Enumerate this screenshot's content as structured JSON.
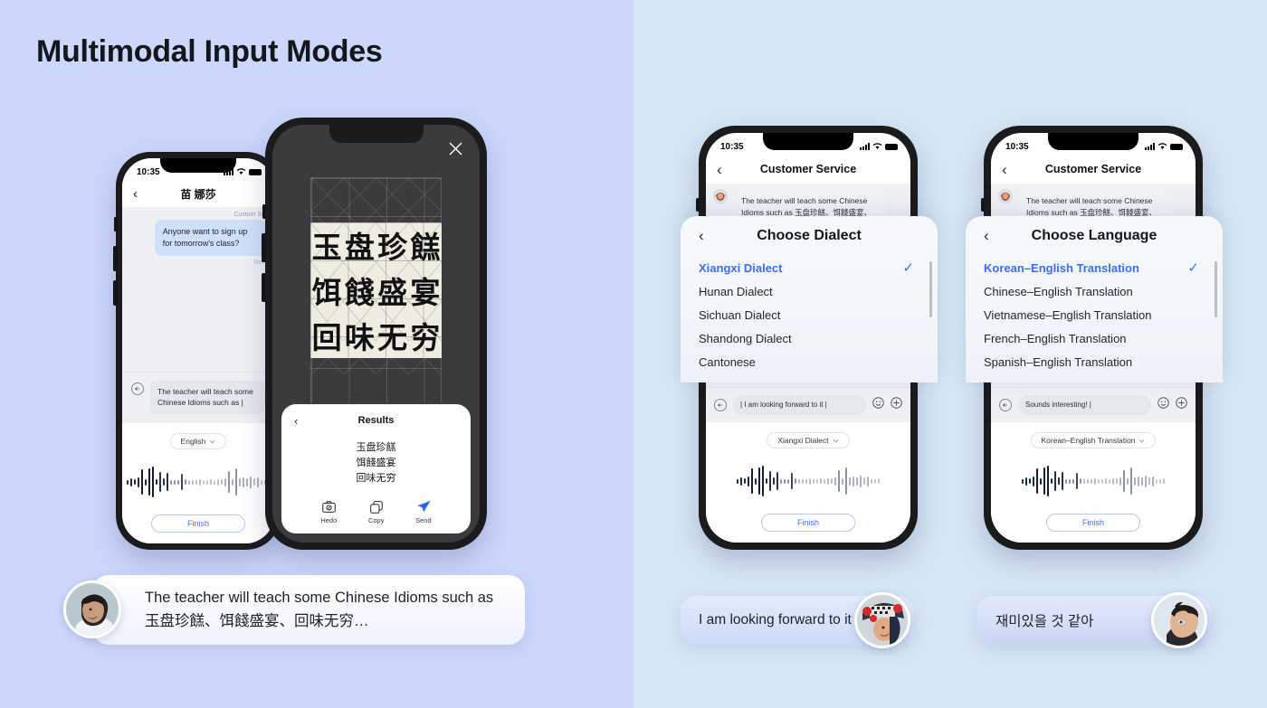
{
  "page": {
    "title": "Multimodal Input Modes",
    "bg_left": "#ccd7fc",
    "bg_right": "#d5e6f4",
    "accent": "#3b6df2"
  },
  "phone_chat": {
    "status": {
      "time": "10:35"
    },
    "nav": {
      "back": "‹",
      "title": "苗 娜莎"
    },
    "chat": {
      "meta_top": "Custom Se",
      "bubble": "Anyone want to sign up for tomorrow's class?",
      "meta_bottom": "Rec"
    },
    "composer": {
      "mic_icon": "speaker-icon",
      "text": "The teacher will teach some Chinese Idioms such as |"
    },
    "voice": {
      "lang_chip": "English",
      "chevron": "⌄",
      "finish": "Finish"
    }
  },
  "phone_dark": {
    "close_icon": "close-icon",
    "hanzi": [
      "玉",
      "盘",
      "珍",
      "餻",
      "饵",
      "餞",
      "盛",
      "宴",
      "回",
      "味",
      "无",
      "穷"
    ],
    "results": {
      "back": "‹",
      "title": "Results",
      "lines": [
        "玉盘珍餻",
        "饵餞盛宴",
        "回味无穷"
      ],
      "actions": [
        {
          "label": "Hedo",
          "icon": "camera-icon"
        },
        {
          "label": "Copy",
          "icon": "copy-icon"
        },
        {
          "label": "Send",
          "icon": "send-icon"
        }
      ]
    }
  },
  "phone_dialect": {
    "status": {
      "time": "10:35"
    },
    "nav": {
      "back": "‹",
      "title": "Customer Service"
    },
    "chat_bubble": "The teacher will teach some Chinese Idioms such as 玉盘珍餻、饵餞盛宴、回味无穷…",
    "sheet": {
      "back": "‹",
      "title": "Choose Dialect",
      "items": [
        {
          "label": "Xiangxi Dialect",
          "selected": true
        },
        {
          "label": "Hunan Dialect",
          "selected": false
        },
        {
          "label": "Sichuan Dialect",
          "selected": false
        },
        {
          "label": "Shandong Dialect",
          "selected": false
        },
        {
          "label": "Cantonese",
          "selected": false
        }
      ],
      "check": "✓"
    },
    "composer": {
      "text": "| I am looking forward to it |",
      "emoji_icon": "smiley-icon",
      "plus_icon": "plus-icon"
    },
    "voice": {
      "lang_chip": "Xiangxi Dialect",
      "chevron": "⌄",
      "finish": "Finish"
    }
  },
  "phone_language": {
    "status": {
      "time": "10:35"
    },
    "nav": {
      "back": "‹",
      "title": "Customer Service"
    },
    "chat_bubble": "The teacher will teach some Chinese Idioms such as 玉盘珍餻、饵餞盛宴、回味无穷…",
    "sheet": {
      "back": "‹",
      "title": "Choose Language",
      "items": [
        {
          "label": "Korean–English Translation",
          "selected": true
        },
        {
          "label": "Chinese–English Translation",
          "selected": false
        },
        {
          "label": "Vietnamese–English Translation",
          "selected": false
        },
        {
          "label": "French–English Translation",
          "selected": false
        },
        {
          "label": "Spanish–English Translation",
          "selected": false
        }
      ],
      "check": "✓"
    },
    "composer": {
      "text": "Sounds interesting! |",
      "emoji_icon": "smiley-icon",
      "plus_icon": "plus-icon"
    },
    "voice": {
      "lang_chip": "Korean–English Translation",
      "chevron": "⌄",
      "finish": "Finish"
    }
  },
  "callouts": {
    "left": {
      "text": "The teacher will teach some Chinese Idioms such as 玉盘珍餻、饵餞盛宴、回味无穷…",
      "avatar": "woman-avatar"
    },
    "middle": {
      "text": "I am looking forward to it",
      "avatar": "girl-hmong-hat-avatar"
    },
    "right": {
      "text": "재미있을 것 같아",
      "avatar": "man-avatar"
    }
  }
}
